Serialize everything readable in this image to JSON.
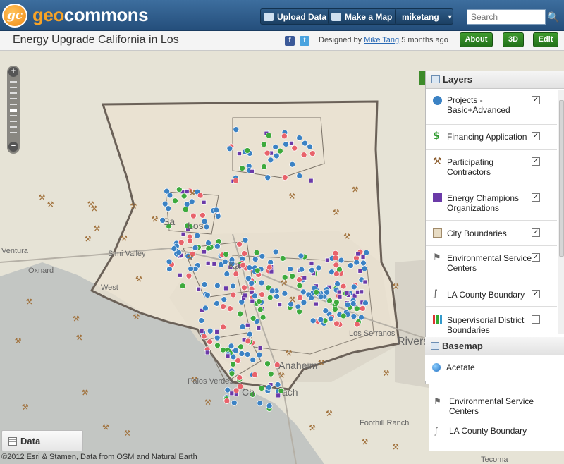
{
  "header": {
    "logo_badge": "gc",
    "logo_geo": "geo",
    "logo_commons": "commons",
    "upload_label": "Upload Data",
    "make_map_label": "Make a Map",
    "user_label": "miketang",
    "search_placeholder": "Search"
  },
  "titlebar": {
    "title": "Energy Upgrade California in Los",
    "designed_by": "Designed by",
    "author": "Mike Tang",
    "time_ago": "5 months ago",
    "about_label": "About",
    "three_d_label": "3D",
    "edit_label": "Edit",
    "facebook_icon_glyph": "f",
    "twitter_icon_glyph": "t"
  },
  "zoom": {
    "plus": "+",
    "minus": "−"
  },
  "layers": {
    "heading": "Layers",
    "items": [
      {
        "label": "Projects - Basic+Advanced",
        "checked": true,
        "icon": "blue-circle-icon"
      },
      {
        "label": "Financing Application",
        "checked": true,
        "icon": "dollar-icon"
      },
      {
        "label": "Participating Contractors",
        "checked": true,
        "icon": "hammer-icon"
      },
      {
        "label": "Energy Champions Organizations",
        "checked": true,
        "icon": "purple-square-icon"
      },
      {
        "label": "City Boundaries",
        "checked": true,
        "icon": "map-outline-icon"
      },
      {
        "label": "Environmental Service Centers",
        "checked": true,
        "icon": "flag-icon"
      },
      {
        "label": "LA County Boundary",
        "checked": true,
        "icon": "boundary-line-icon"
      },
      {
        "label": "Supervisorial District Boundaries",
        "checked": false,
        "icon": "district-bars-icon"
      }
    ]
  },
  "basemap": {
    "heading": "Basemap",
    "current": "Acetate"
  },
  "layers_under": [
    {
      "label": "Environmental Service Centers"
    },
    {
      "label": "LA County Boundary"
    }
  ],
  "data_tab": {
    "label": "Data"
  },
  "attribution": "©2012 Esri & Stamen, Data from OSM and Natural Earth",
  "places": [
    {
      "label": "Ventura"
    },
    {
      "label": "Oxnard"
    },
    {
      "label": "Simi Valley"
    },
    {
      "label": "Los Serranos"
    },
    {
      "label": "Rivers"
    },
    {
      "label": "Anaheim"
    },
    {
      "label": "Foothill Ranch"
    },
    {
      "label": "Tecoma"
    },
    {
      "label": "Sa"
    },
    {
      "label": "Los"
    },
    {
      "label": "West"
    },
    {
      "label": "Ka"
    },
    {
      "label": "Palos Verdes"
    },
    {
      "label": "Ch"
    },
    {
      "label": "ach"
    }
  ],
  "colors": {
    "projects": "#3b82c4",
    "financing": "#e8636b",
    "financing_app": "#3daa3d",
    "contractors": "#a0703a",
    "champions": "#6b3aa8",
    "county_boundary": "#6b6158",
    "header_blue": "#2c5a88",
    "green_button": "#2f8a24"
  }
}
